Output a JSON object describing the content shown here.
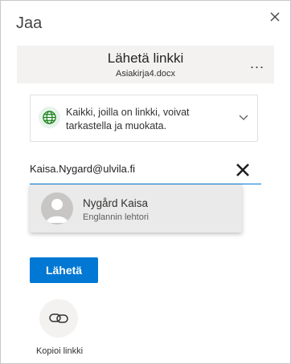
{
  "dialog": {
    "title": "Jaa",
    "close_icon": "close-icon"
  },
  "header": {
    "title": "Lähetä linkki",
    "filename": "Asiakirja4.docx",
    "more_label": "..."
  },
  "permission": {
    "icon": "globe-icon",
    "text": "Kaikki, joilla on linkki, voivat tarkastella ja muokata."
  },
  "recipient": {
    "value": "Kaisa.Nygard@ulvila.fi",
    "clear_icon": "clear-icon"
  },
  "suggestion": {
    "name": "Nygård Kaisa",
    "role": "Englannin lehtori"
  },
  "actions": {
    "send_label": "Lähetä",
    "copy_label": "Kopioi linkki"
  },
  "colors": {
    "accent": "#0078d4",
    "globe": "#107c10"
  }
}
